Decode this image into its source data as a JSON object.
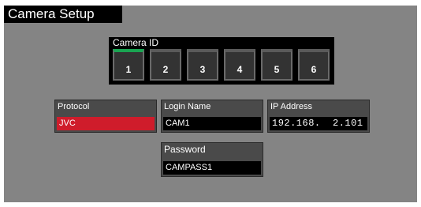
{
  "window": {
    "title": "Camera Setup"
  },
  "camera_id": {
    "label": "Camera ID",
    "buttons": [
      "1",
      "2",
      "3",
      "4",
      "5",
      "6"
    ],
    "selected": "1",
    "active_color": "#1aa552"
  },
  "fields": {
    "protocol": {
      "label": "Protocol",
      "value": "JVC",
      "value_color": "#cf1c2b"
    },
    "login_name": {
      "label": "Login Name",
      "value": "CAM1"
    },
    "ip_address": {
      "label": "IP Address",
      "value": "192.168.  2.101"
    },
    "password": {
      "label": "Password",
      "value": "CAMPASS1"
    }
  }
}
